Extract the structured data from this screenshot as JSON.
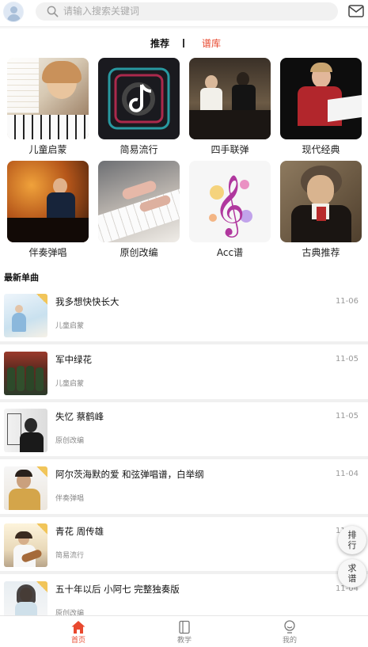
{
  "header": {
    "avatar_icon": "user-avatar-icon",
    "search": {
      "placeholder": "请输入搜索关键词",
      "icon": "search-icon"
    },
    "mail_icon": "mail-icon"
  },
  "tabs": [
    {
      "label": "推荐",
      "active": false
    },
    {
      "label": "谱库",
      "active": true
    }
  ],
  "accent_color": "#e8492f",
  "categories": [
    {
      "label": "儿童启蒙"
    },
    {
      "label": "简易流行"
    },
    {
      "label": "四手联弹"
    },
    {
      "label": "现代经典"
    },
    {
      "label": "伴奏弹唱"
    },
    {
      "label": "原创改编"
    },
    {
      "label": "Acc谱"
    },
    {
      "label": "古典推荐"
    }
  ],
  "latest": {
    "title": "最新单曲",
    "songs": [
      {
        "title": "我多想快快长大",
        "tag": "儿童启蒙",
        "date": "11-06"
      },
      {
        "title": "军中绿花",
        "tag": "儿童启蒙",
        "date": "11-05"
      },
      {
        "title": "失忆 蔡鹤峰",
        "tag": "原创改编",
        "date": "11-05"
      },
      {
        "title": "阿尔茨海默的爱 和弦弹唱谱，白举纲",
        "tag": "伴奏弹唱",
        "date": "11-04"
      },
      {
        "title": "青花 周传雄",
        "tag": "简易流行",
        "date": "11-04"
      },
      {
        "title": "五十年以后 小阿七 完整独奏版",
        "tag": "原创改编",
        "date": "11-04"
      }
    ]
  },
  "floating": {
    "rank": "排行",
    "request": "求谱"
  },
  "bottom_nav": [
    {
      "label": "首页",
      "icon": "home-icon",
      "active": true
    },
    {
      "label": "教学",
      "icon": "book-icon",
      "active": false
    },
    {
      "label": "我的",
      "icon": "profile-icon",
      "active": false
    }
  ]
}
